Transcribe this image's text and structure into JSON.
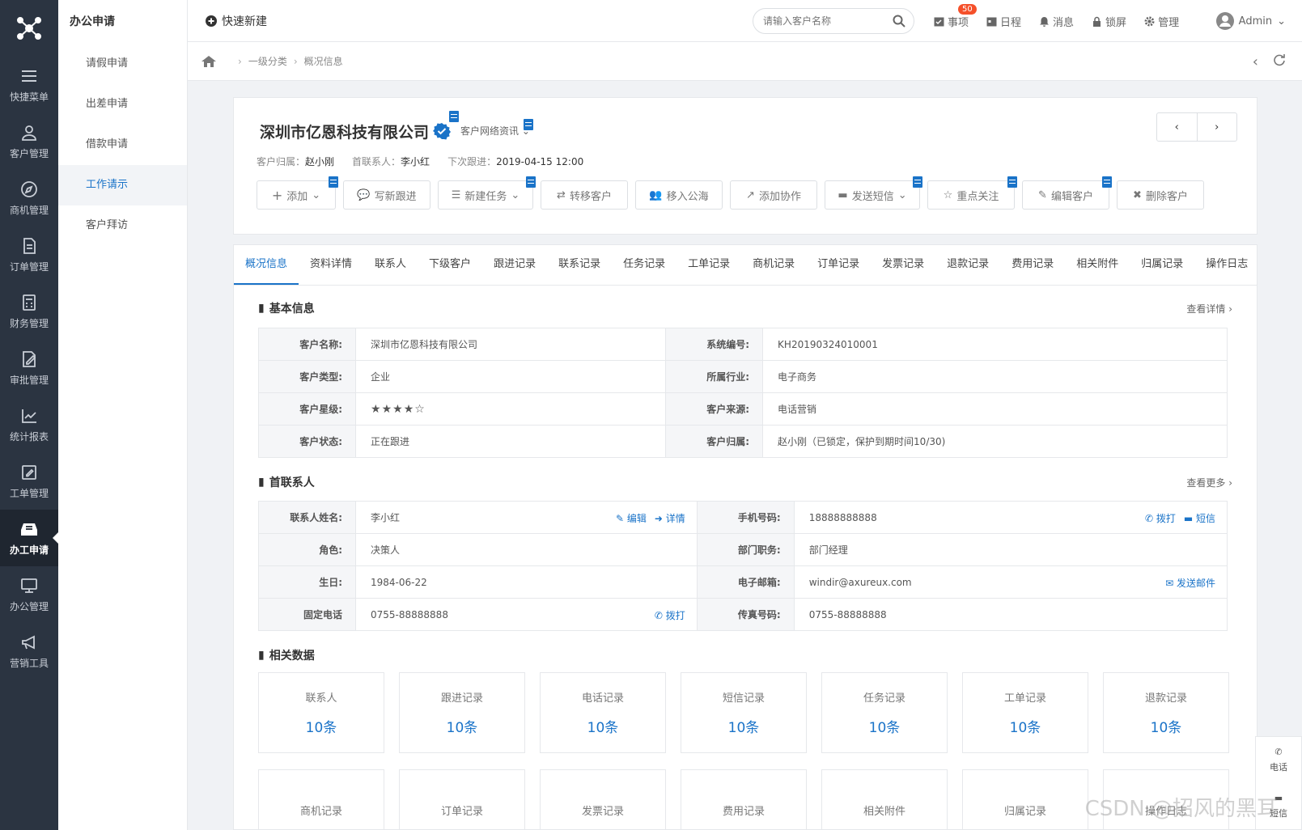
{
  "rail": {
    "items": [
      {
        "label": "快捷菜单"
      },
      {
        "label": "客户管理"
      },
      {
        "label": "商机管理"
      },
      {
        "label": "订单管理"
      },
      {
        "label": "财务管理"
      },
      {
        "label": "审批管理"
      },
      {
        "label": "统计报表"
      },
      {
        "label": "工单管理"
      },
      {
        "label": "办工申请"
      },
      {
        "label": "办公管理"
      },
      {
        "label": "营销工具"
      }
    ]
  },
  "submenu": {
    "title": "办公申请",
    "items": [
      {
        "label": "请假申请"
      },
      {
        "label": "出差申请"
      },
      {
        "label": "借款申请"
      },
      {
        "label": "工作请示"
      },
      {
        "label": "客户拜访"
      }
    ]
  },
  "topbar": {
    "quick_new": "快速新建",
    "search_placeholder": "请输入客户名称",
    "events_label": "事项",
    "events_badge": "50",
    "schedule_label": "日程",
    "messages_label": "消息",
    "lock_label": "锁屏",
    "manage_label": "管理",
    "user": "Admin"
  },
  "breadcrumb": {
    "level1": "一级分类",
    "level2": "概况信息"
  },
  "header": {
    "company": "深圳市亿恩科技有限公司",
    "net_info": "客户网络资讯",
    "owner_label": "客户归属：",
    "owner": "赵小刚",
    "contact_label": "首联系人：",
    "contact": "李小红",
    "next_label": "下次跟进：",
    "next": "2019-04-15 12:00",
    "actions": {
      "add": "添加",
      "follow": "写新跟进",
      "task": "新建任务",
      "transfer": "转移客户",
      "pool": "移入公海",
      "collab": "添加协作",
      "sms": "发送短信",
      "focus": "重点关注",
      "edit": "编辑客户",
      "delete": "删除客户"
    }
  },
  "tabs": [
    "概况信息",
    "资料详情",
    "联系人",
    "下级客户",
    "跟进记录",
    "联系记录",
    "任务记录",
    "工单记录",
    "商机记录",
    "订单记录",
    "发票记录",
    "退款记录",
    "费用记录",
    "相关附件",
    "归属记录",
    "操作日志"
  ],
  "basic": {
    "title": "基本信息",
    "more": "查看详情",
    "rows": [
      {
        "l1": "客户名称:",
        "v1": "深圳市亿恩科技有限公司",
        "l2": "系统编号:",
        "v2": "KH20190324010001"
      },
      {
        "l1": "客户类型:",
        "v1": "企业",
        "l2": "所属行业:",
        "v2": "电子商务"
      },
      {
        "l1": "客户星级:",
        "v1": "",
        "l2": "客户来源:",
        "v2": "电话营销"
      },
      {
        "l1": "客户状态:",
        "v1": "正在跟进",
        "l2": "客户归属:",
        "v2": "赵小刚（已锁定，保护到期时间10/30)"
      }
    ],
    "stars": 4
  },
  "contact": {
    "title": "首联系人",
    "more": "查看更多",
    "rows": [
      {
        "l1": "联系人姓名:",
        "v1": "李小红",
        "l2": "手机号码:",
        "v2": "18888888888"
      },
      {
        "l1": "角色:",
        "v1": "决策人",
        "l2": "部门职务:",
        "v2": "部门经理"
      },
      {
        "l1": "生日:",
        "v1": "1984-06-22",
        "l2": "电子邮箱:",
        "v2": "windir@axureux.com"
      },
      {
        "l1": "固定电话",
        "v1": "0755-88888888",
        "l2": "传真号码:",
        "v2": "0755-88888888"
      }
    ],
    "edit": "编辑",
    "detail": "详情",
    "call": "拨打",
    "sms": "短信",
    "mail": "发送邮件"
  },
  "related": {
    "title": "相关数据",
    "row1": [
      {
        "t": "联系人",
        "v": "10条"
      },
      {
        "t": "跟进记录",
        "v": "10条"
      },
      {
        "t": "电话记录",
        "v": "10条"
      },
      {
        "t": "短信记录",
        "v": "10条"
      },
      {
        "t": "任务记录",
        "v": "10条"
      },
      {
        "t": "工单记录",
        "v": "10条"
      },
      {
        "t": "退款记录",
        "v": "10条"
      }
    ],
    "row2": [
      {
        "t": "商机记录"
      },
      {
        "t": "订单记录"
      },
      {
        "t": "发票记录"
      },
      {
        "t": "费用记录"
      },
      {
        "t": "相关附件"
      },
      {
        "t": "归属记录"
      },
      {
        "t": "操作日志"
      }
    ]
  },
  "float": {
    "phone": "电话",
    "sms": "短信"
  },
  "watermark": "CSDN @招风的黑耳",
  "colors": {
    "accent": "#1a73c8",
    "rail": "#2b3441",
    "badge": "#f5502a"
  }
}
